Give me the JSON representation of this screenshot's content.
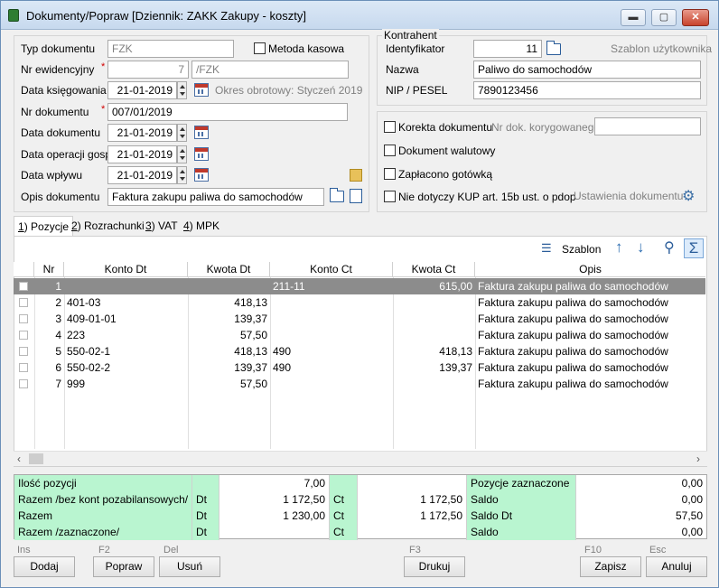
{
  "window": {
    "title": "Dokumenty/Popraw [Dziennik: ZAKK  Zakupy - koszty]",
    "minimize": "▬",
    "maximize": "▢",
    "close": "✕"
  },
  "doc": {
    "typ_label": "Typ dokumentu",
    "typ_value": "FZK",
    "metoda_label": "Metoda kasowa",
    "nrew_label": "Nr ewidencyjny",
    "nrew_value": "7",
    "nrew_suffix": "/FZK",
    "datak_label": "Data księgowania",
    "datak_value": "21-01-2019",
    "okres_text": "Okres obrotowy: Styczeń 2019",
    "nrdok_label": "Nr dokumentu",
    "nrdok_value": "007/01/2019",
    "datadok_label": "Data dokumentu",
    "datadok_value": "21-01-2019",
    "dataop_label": "Data operacji gosp.",
    "dataop_value": "21-01-2019",
    "datawp_label": "Data wpływu",
    "datawp_value": "21-01-2019",
    "opis_label": "Opis dokumentu",
    "opis_value": "Faktura zakupu paliwa do samochodów",
    "required_mark": "*"
  },
  "kontrahent": {
    "group_label": "Kontrahent",
    "id_label": "Identyfikator",
    "id_value": "11",
    "szablon_link": "Szablon użytkownika",
    "nazwa_label": "Nazwa",
    "nazwa_value": "Paliwo do samochodów",
    "nip_label": "NIP / PESEL",
    "nip_value": "7890123456"
  },
  "options": {
    "korekta_label": "Korekta dokumentu",
    "nrkor_label": "Nr dok. korygowanego",
    "walutowy_label": "Dokument walutowy",
    "gotowka_label": "Zapłacono gotówką",
    "kup_label": "Nie dotyczy KUP art. 15b ust. o pdop",
    "ustawienia_label": "Ustawienia dokumentu"
  },
  "tabs": [
    {
      "key": "1",
      "label": ") Pozycje"
    },
    {
      "key": "2",
      "label": ") Rozrachunki"
    },
    {
      "key": "3",
      "label": ") VAT"
    },
    {
      "key": "4",
      "label": ") MPK"
    }
  ],
  "toolbar": {
    "szablon_label": "Szablon"
  },
  "grid": {
    "columns": [
      "Nr",
      "Konto Dt",
      "Kwota Dt",
      "Konto Ct",
      "Kwota Ct",
      "Opis"
    ],
    "rows": [
      {
        "nr": "1",
        "konto_dt": "",
        "kwota_dt": "",
        "konto_ct": "211-11",
        "kwota_ct": "615,00",
        "opis": "Faktura zakupu paliwa do samochodów"
      },
      {
        "nr": "2",
        "konto_dt": "401-03",
        "kwota_dt": "418,13",
        "konto_ct": "",
        "kwota_ct": "",
        "opis": "Faktura zakupu paliwa do samochodów"
      },
      {
        "nr": "3",
        "konto_dt": "409-01-01",
        "kwota_dt": "139,37",
        "konto_ct": "",
        "kwota_ct": "",
        "opis": "Faktura zakupu paliwa do samochodów"
      },
      {
        "nr": "4",
        "konto_dt": "223",
        "kwota_dt": "57,50",
        "konto_ct": "",
        "kwota_ct": "",
        "opis": "Faktura zakupu paliwa do samochodów"
      },
      {
        "nr": "5",
        "konto_dt": "550-02-1",
        "kwota_dt": "418,13",
        "konto_ct": "490",
        "kwota_ct": "418,13",
        "opis": "Faktura zakupu paliwa do samochodów"
      },
      {
        "nr": "6",
        "konto_dt": "550-02-2",
        "kwota_dt": "139,37",
        "konto_ct": "490",
        "kwota_ct": "139,37",
        "opis": "Faktura zakupu paliwa do samochodów"
      },
      {
        "nr": "7",
        "konto_dt": "999",
        "kwota_dt": "57,50",
        "konto_ct": "",
        "kwota_ct": "",
        "opis": "Faktura zakupu paliwa do samochodów"
      }
    ]
  },
  "summary": {
    "ilosc_label": "Ilość pozycji",
    "ilosc_value": "7,00",
    "razem_bez_label": "Razem /bez kont pozabilansowych/",
    "razem_bez_dt_label": "Dt",
    "razem_bez_dt": "1 172,50",
    "razem_bez_ct_label": "Ct",
    "razem_bez_ct": "1 172,50",
    "razem_label": "Razem",
    "razem_dt_label": "Dt",
    "razem_dt": "1 230,00",
    "razem_ct_label": "Ct",
    "razem_ct": "1 172,50",
    "razem_zazn_label": "Razem /zaznaczone/",
    "razem_zazn_dt_label": "Dt",
    "razem_zazn_ct_label": "Ct",
    "poz_zazn_label": "Pozycje zaznaczone",
    "poz_zazn_value": "0,00",
    "saldo_label": "Saldo",
    "saldo_value": "0,00",
    "saldo_dt_label": "Saldo Dt",
    "saldo_dt_value": "57,50",
    "saldo2_label": "Saldo",
    "saldo2_value": "0,00"
  },
  "buttons": {
    "dodaj": {
      "key": "Ins",
      "label": "Dodaj"
    },
    "popraw": {
      "key": "F2",
      "label": "Popraw"
    },
    "usun": {
      "key": "Del",
      "label": "Usuń"
    },
    "drukuj": {
      "key": "F3",
      "label": "Drukuj"
    },
    "zapisz": {
      "key": "F10",
      "label": "Zapisz"
    },
    "anuluj": {
      "key": "Esc",
      "label": "Anuluj"
    }
  }
}
